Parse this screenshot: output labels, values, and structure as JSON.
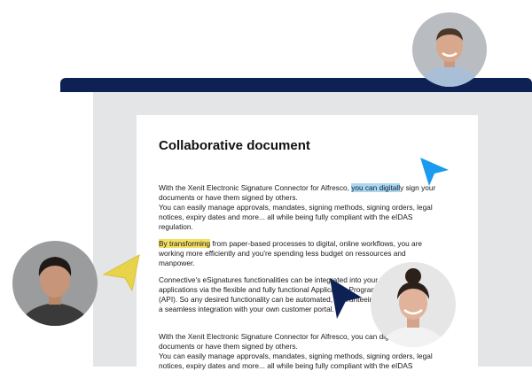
{
  "document": {
    "title": "Collaborative document",
    "p1": [
      {
        "pre": "With the Xenit Electronic Signature Connector for Alfresco, ",
        "hl": "you can digitall",
        "post": "y sign your"
      },
      {
        "text": "documents or have them signed by others."
      },
      {
        "text": "You can easily manage approvals, mandates, signing methods, signing orders, legal"
      },
      {
        "text": "notices, expiry dates and more... all while being fully compliant with the eIDAS"
      },
      {
        "text": "regulation."
      }
    ],
    "p2": [
      {
        "hl": "By transforming",
        "post": " from paper-based processes to digital, online workflows, you are"
      },
      {
        "text": "working more efficiently and you're spending less budget on ressources and"
      },
      {
        "text": "manpower."
      }
    ],
    "p3": [
      {
        "text": "Connective's eSignatures functionalities can be integrated into your"
      },
      {
        "text": "applications via the flexible and fully functional Application Programming Interface"
      },
      {
        "text": "(API). So any desired functionality can be automated, guaranteeing"
      },
      {
        "text": "a seamless integration with your own customer portal."
      }
    ],
    "p4": [
      {
        "text": "With the Xenit Electronic Signature Connector for Alfresco, you can digitally sign your"
      },
      {
        "text": "documents or have them signed by others."
      },
      {
        "text": "You can easily manage approvals, mandates, signing methods, signing orders, legal"
      },
      {
        "text": "notices, expiry dates and more... all while being fully compliant with the eIDAS"
      }
    ]
  },
  "collaborators": [
    {
      "id": "top",
      "cursor_color": "#1a9bf0"
    },
    {
      "id": "left",
      "cursor_color": "#e8d44a"
    },
    {
      "id": "right",
      "cursor_color": "#0d2154"
    }
  ],
  "colors": {
    "window_bar": "#0d2154",
    "window_body": "#e4e5e7",
    "highlight_blue": "#a9d8f7",
    "highlight_yellow": "#f3e065"
  }
}
